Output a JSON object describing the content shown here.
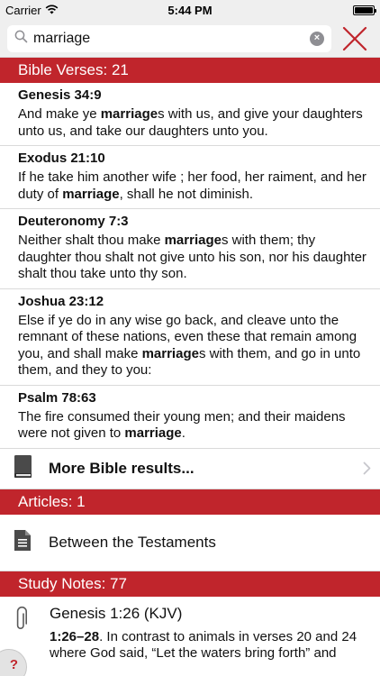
{
  "status_bar": {
    "carrier": "Carrier",
    "time": "5:44 PM",
    "battery_level": 1.0
  },
  "search": {
    "value": "marriage",
    "placeholder": "Search",
    "clear_label": "×"
  },
  "sections": {
    "verses": {
      "header": "Bible Verses: 21",
      "items": [
        {
          "ref": "Genesis 34:9",
          "pre": "And make ye ",
          "hl": "marriage",
          "post": "s with us, and give your daughters unto us, and take our daughters unto you."
        },
        {
          "ref": "Exodus 21:10",
          "pre": "If he take him another wife ; her food, her raiment, and her duty of ",
          "hl": "marriage",
          "post": ", shall he not diminish."
        },
        {
          "ref": "Deuteronomy 7:3",
          "pre": "Neither shalt thou make ",
          "hl": "marriage",
          "post": "s with them; thy daughter thou shalt not give unto his son, nor his daughter shalt thou take unto thy son."
        },
        {
          "ref": "Joshua 23:12",
          "pre": "Else if ye do in any wise go back, and cleave unto the remnant of these nations, even these that remain among you, and shall make ",
          "hl": "marriage",
          "post": "s with them, and go in unto them, and they to you:"
        },
        {
          "ref": "Psalm 78:63",
          "pre": "The fire consumed their young men; and their maidens were not given to ",
          "hl": "marriage",
          "post": "."
        }
      ],
      "more_label": "More Bible results..."
    },
    "articles": {
      "header": "Articles: 1",
      "items": [
        {
          "title": "Between the Testaments"
        }
      ]
    },
    "study_notes": {
      "header": "Study Notes: 77",
      "items": [
        {
          "title": "Genesis 1:26 (KJV)",
          "ref": "1:26–28",
          "text": ". In contrast to animals in verses 20 and 24 where God said, “Let the waters bring forth” and"
        }
      ]
    }
  },
  "help": {
    "label": "?"
  },
  "icons": {
    "search": "search-icon",
    "close": "close-x-icon",
    "book": "book-icon",
    "document": "document-icon",
    "paperclip": "paperclip-icon",
    "chevron": "chevron-right-icon"
  },
  "colors": {
    "accent": "#c0252c",
    "bar_bg": "#efefef"
  }
}
